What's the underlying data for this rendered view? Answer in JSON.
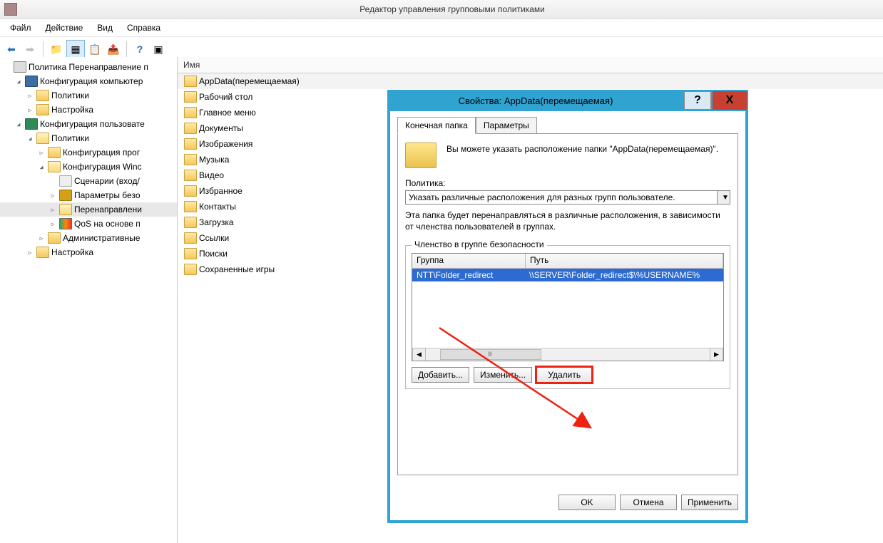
{
  "title": "Редактор управления групповыми политиками",
  "menu": {
    "file": "Файл",
    "action": "Действие",
    "view": "Вид",
    "help": "Справка"
  },
  "tree": [
    {
      "indent": 0,
      "tog": "",
      "icon": "policy",
      "label": "Политика Перенаправление п",
      "sel": false
    },
    {
      "indent": 1,
      "tog": "◢",
      "icon": "comp",
      "label": "Конфигурация компьютер",
      "sel": false
    },
    {
      "indent": 2,
      "tog": "▷",
      "icon": "folder",
      "label": "Политики",
      "sel": false
    },
    {
      "indent": 2,
      "tog": "▷",
      "icon": "folder",
      "label": "Настройка",
      "sel": false
    },
    {
      "indent": 1,
      "tog": "◢",
      "icon": "user",
      "label": "Конфигурация пользовате",
      "sel": false
    },
    {
      "indent": 2,
      "tog": "◢",
      "icon": "folder-open",
      "label": "Политики",
      "sel": false
    },
    {
      "indent": 3,
      "tog": "▷",
      "icon": "folder",
      "label": "Конфигурация прог",
      "sel": false
    },
    {
      "indent": 3,
      "tog": "◢",
      "icon": "folder-open",
      "label": "Конфигурация Winc",
      "sel": false
    },
    {
      "indent": 4,
      "tog": "",
      "icon": "script",
      "label": "Сценарии (вход/",
      "sel": false
    },
    {
      "indent": 4,
      "tog": "▷",
      "icon": "lock",
      "label": "Параметры безо",
      "sel": false
    },
    {
      "indent": 4,
      "tog": "▷",
      "icon": "folder-open",
      "label": "Перенаправлени",
      "sel": true
    },
    {
      "indent": 4,
      "tog": "▷",
      "icon": "qos",
      "label": "QoS на основе п",
      "sel": false
    },
    {
      "indent": 3,
      "tog": "▷",
      "icon": "folder",
      "label": "Административные",
      "sel": false
    },
    {
      "indent": 2,
      "tog": "▷",
      "icon": "folder",
      "label": "Настройка",
      "sel": false
    }
  ],
  "list": {
    "header": "Имя",
    "rows": [
      {
        "label": "AppData(перемещаемая)",
        "sel": true
      },
      {
        "label": "Рабочий стол",
        "sel": false
      },
      {
        "label": "Главное меню",
        "sel": false
      },
      {
        "label": "Документы",
        "sel": false
      },
      {
        "label": "Изображения",
        "sel": false
      },
      {
        "label": "Музыка",
        "sel": false
      },
      {
        "label": "Видео",
        "sel": false
      },
      {
        "label": "Избранное",
        "sel": false
      },
      {
        "label": "Контакты",
        "sel": false
      },
      {
        "label": "Загрузка",
        "sel": false
      },
      {
        "label": "Ссылки",
        "sel": false
      },
      {
        "label": "Поиски",
        "sel": false
      },
      {
        "label": "Сохраненные игры",
        "sel": false
      }
    ]
  },
  "dialog": {
    "title": "Свойства: AppData(перемещаемая)",
    "help": "?",
    "close": "X",
    "tabs": {
      "target": "Конечная папка",
      "params": "Параметры"
    },
    "intro": "Вы можете указать расположение папки \"AppData(перемещаемая)\".",
    "policy_label": "Политика:",
    "policy_value": "Указать различные расположения для разных групп пользователе.",
    "policy_desc": "Эта папка будет перенаправляться в различные расположения, в зависимости от членства пользователей в группах.",
    "group_legend": "Членство в группе безопасности",
    "col_group": "Группа",
    "col_path": "Путь",
    "row": {
      "group": "NTT\\Folder_redirect",
      "path": "\\\\SERVER\\Folder_redirect$\\%USERNAME%"
    },
    "btn_add": "Добавить...",
    "btn_edit": "Изменить...",
    "btn_del": "Удалить",
    "btn_ok": "OK",
    "btn_cancel": "Отмена",
    "btn_apply": "Применить"
  }
}
